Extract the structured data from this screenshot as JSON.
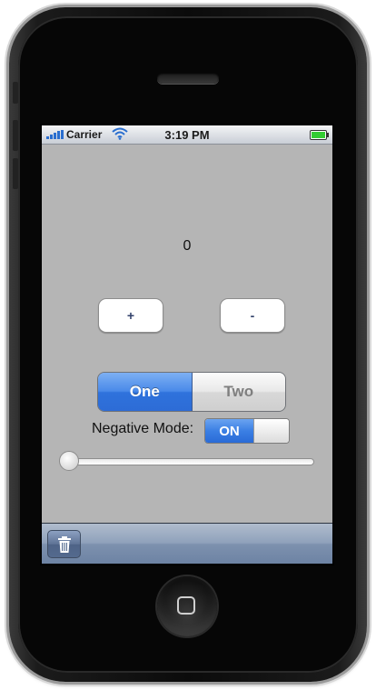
{
  "status_bar": {
    "carrier": "Carrier",
    "time": "3:19 PM",
    "signal_bars": 5,
    "battery_level": 1.0
  },
  "main": {
    "counter_value": "0",
    "plus_button_label": "+",
    "minus_button_label": "-",
    "segments": [
      {
        "label": "One",
        "selected": true
      },
      {
        "label": "Two",
        "selected": false
      }
    ],
    "negative_mode_label": "Negative Mode:",
    "negative_mode_switch_label": "ON",
    "slider_value": 0.0
  },
  "toolbar": {
    "items": [
      {
        "icon": "trash-icon"
      }
    ]
  },
  "colors": {
    "screen_background": "#b5b5b5",
    "segment_selected": "#2f72dc",
    "switch_on": "#3b7fe4",
    "toolbar": "#7d91ae"
  }
}
